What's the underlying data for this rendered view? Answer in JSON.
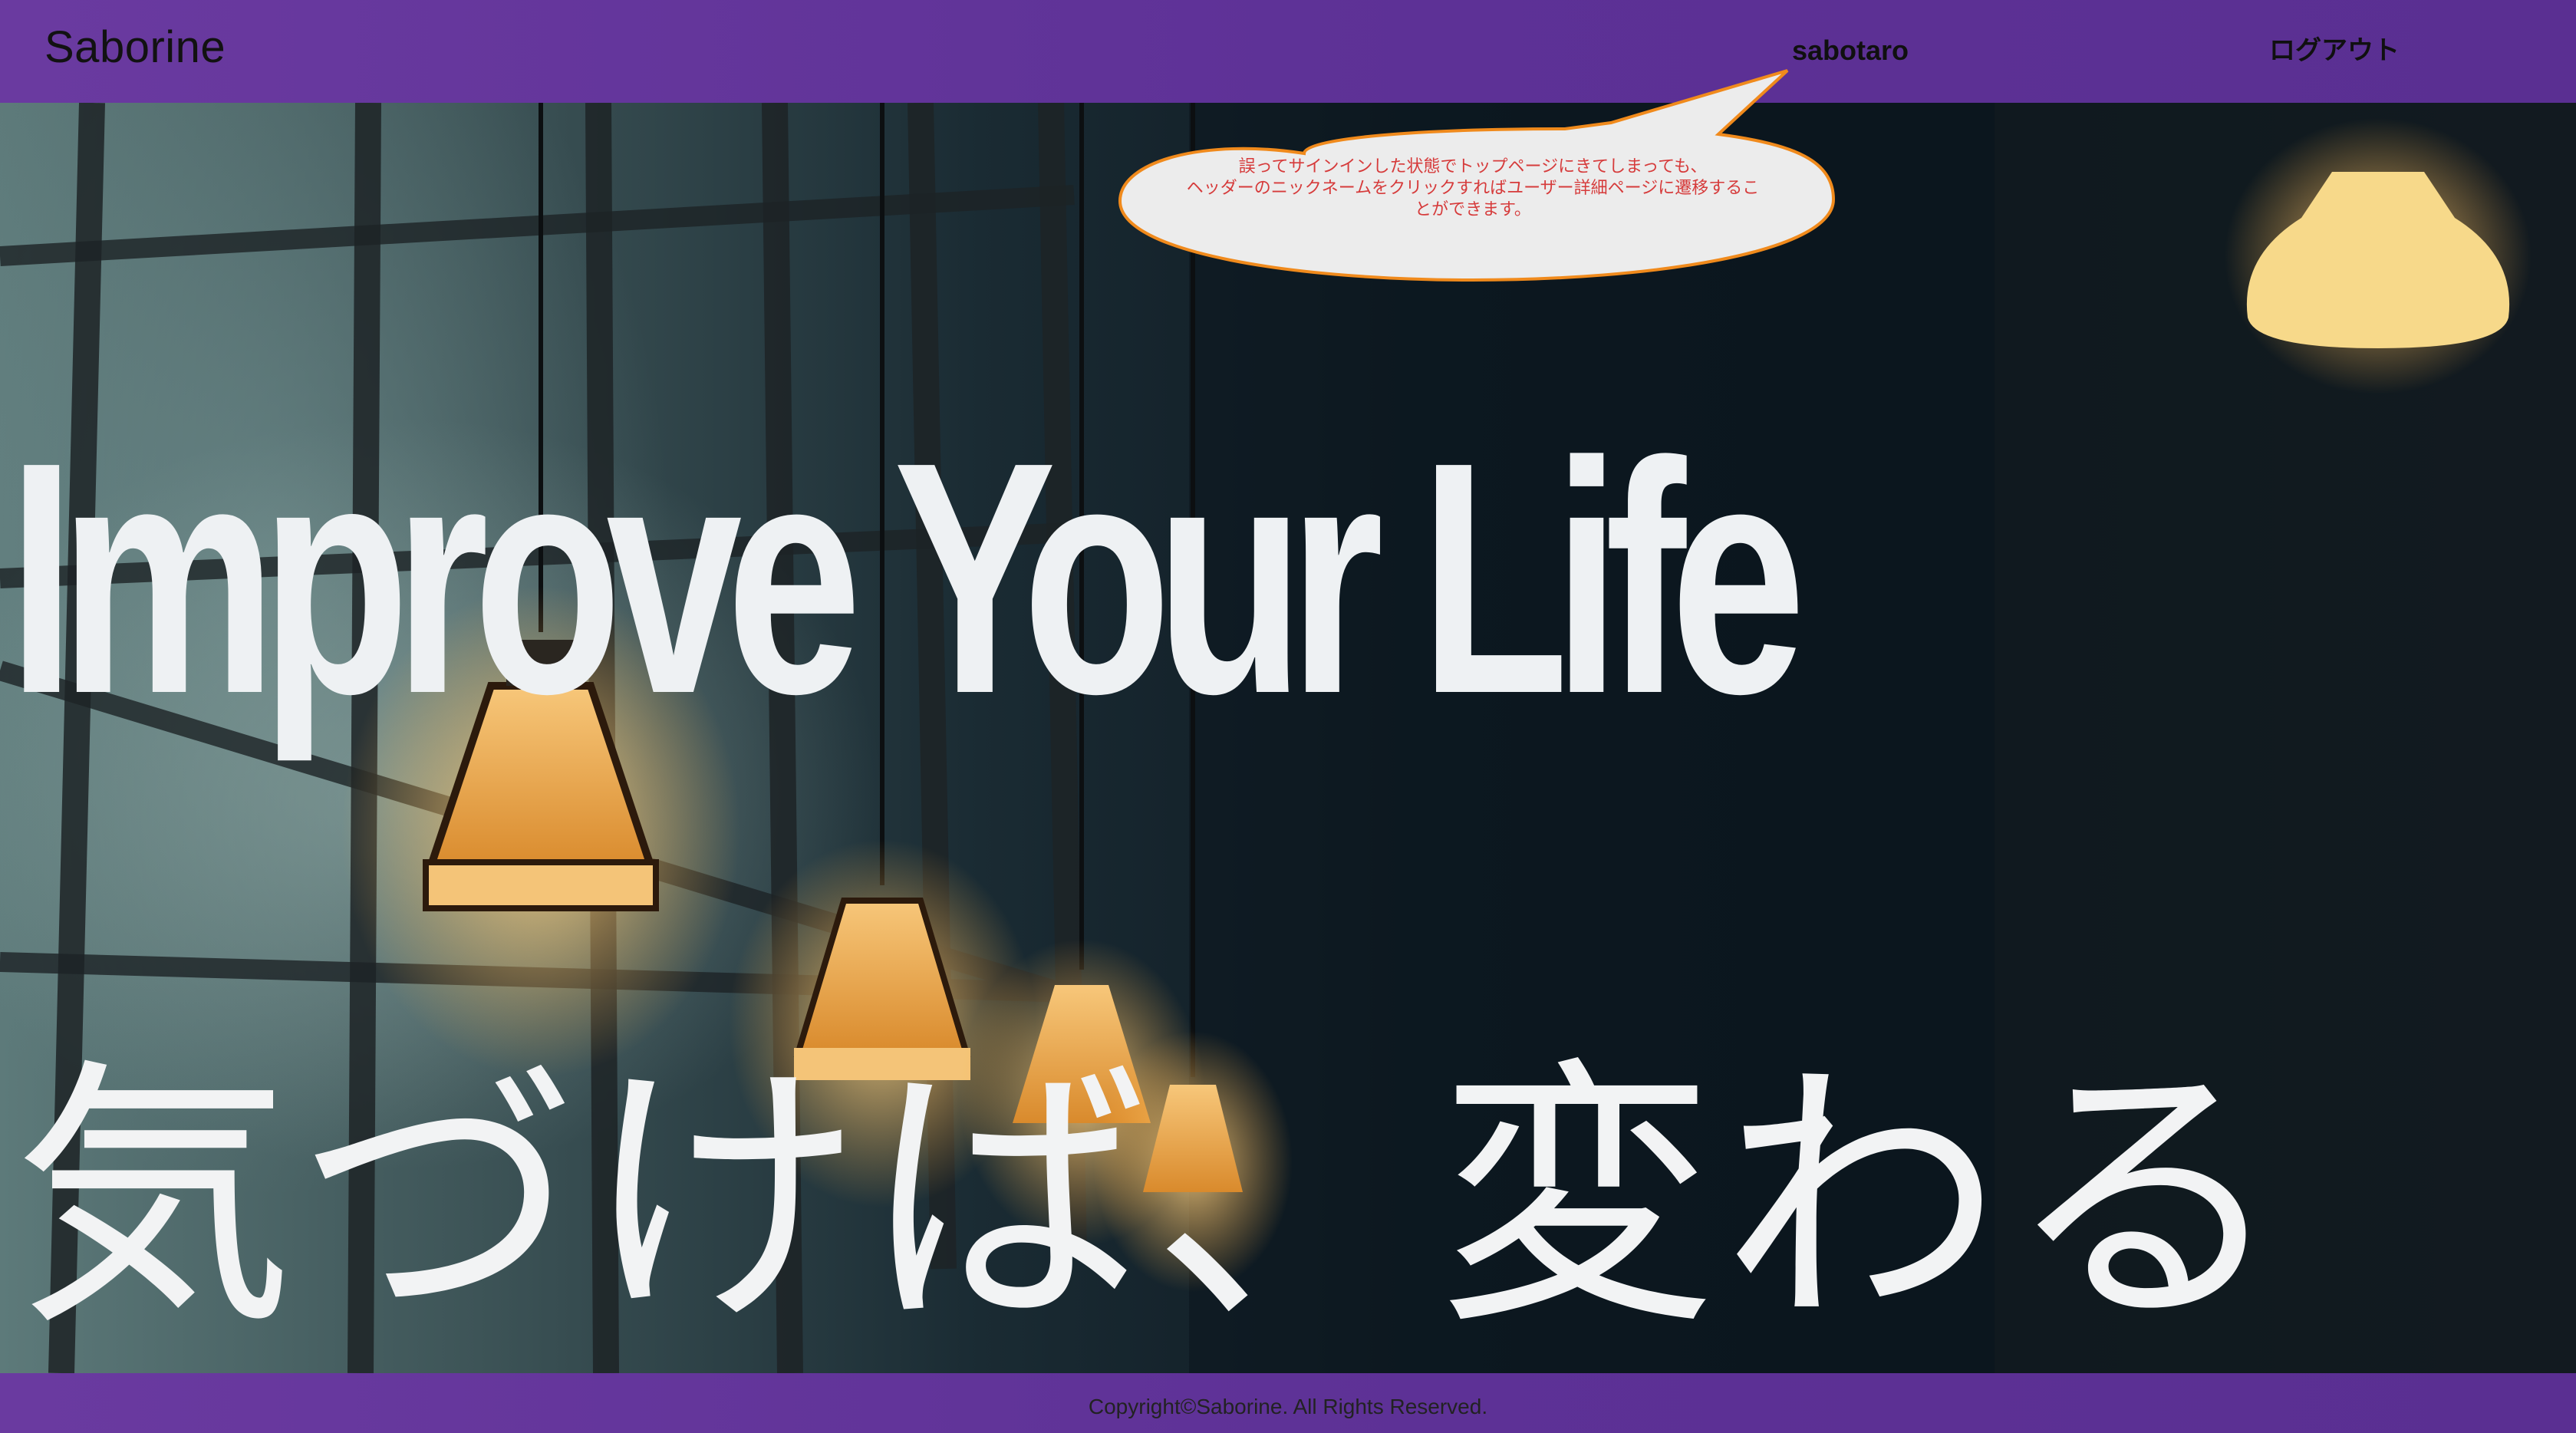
{
  "header": {
    "brand": "Saborine",
    "nickname": "sabotaro",
    "logout_label": "ログアウト"
  },
  "hero": {
    "headline_en": "Improve Your Life",
    "headline_jp": "気づけば、変わる"
  },
  "annotation": {
    "lines": [
      "誤ってサインインした状態でトップページにきてしまっても、",
      "ヘッダーのニックネームをクリックすればユーザー詳細ページに遷移するこ",
      "とができます。"
    ]
  },
  "footer": {
    "copyright": "Copyright©Saborine. All Rights Reserved."
  },
  "colors": {
    "header_bg": "#5d3196",
    "annotation_text": "#d63b3b",
    "annotation_border": "#f08a1c",
    "headline": "#eef1f3"
  }
}
